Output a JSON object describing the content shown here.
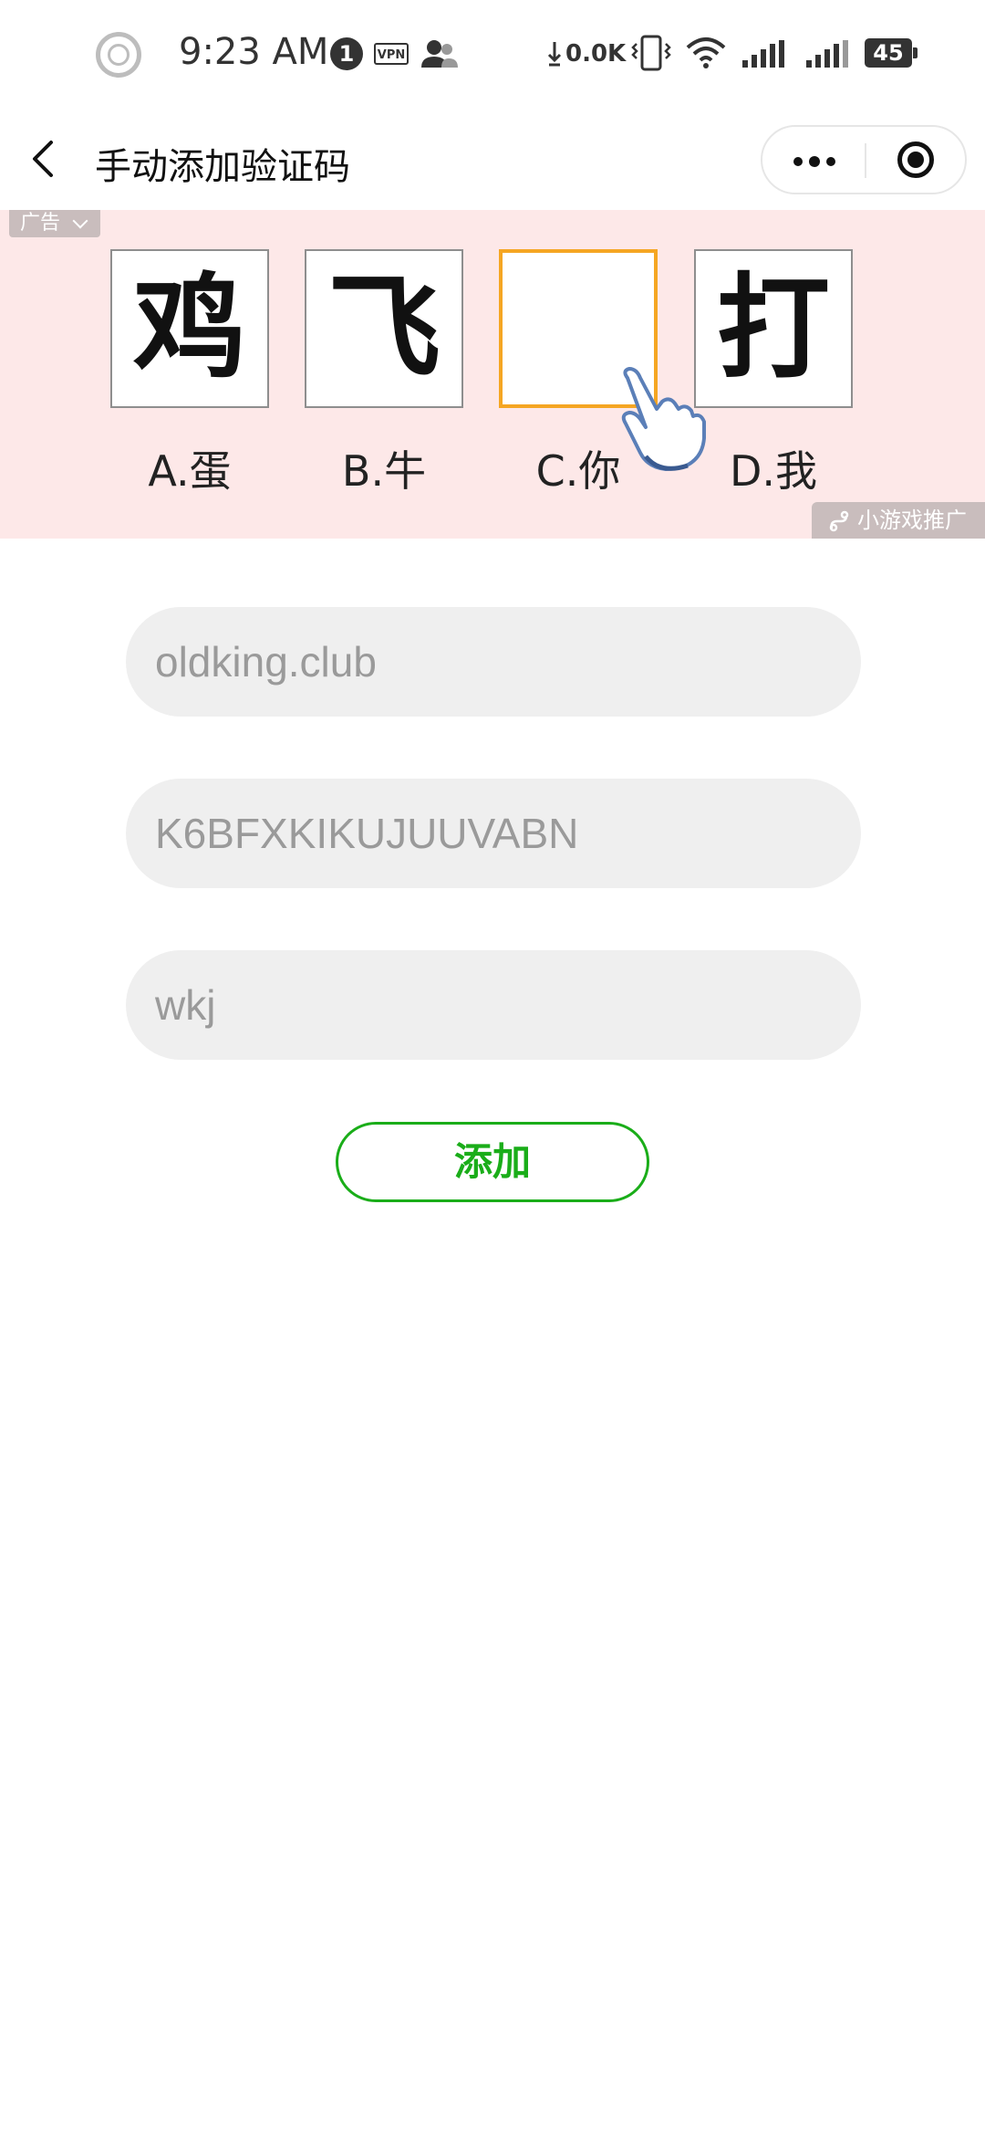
{
  "status_bar": {
    "time": "9:23 AM",
    "notification_count": "1",
    "vpn_label": "VPN",
    "net_speed": "0.0K",
    "battery": "45"
  },
  "nav": {
    "title": "手动添加验证码"
  },
  "ad": {
    "tag_label": "广告",
    "chars": [
      "鸡",
      "飞",
      "",
      "打"
    ],
    "options": [
      "A.蛋",
      "B.牛",
      "C.你",
      "D.我"
    ],
    "promo_label": "小游戏推广"
  },
  "form": {
    "field1_placeholder": "oldking.club",
    "field2_placeholder": "K6BFXKIKUJUUVABN",
    "field3_placeholder": "wkj",
    "add_label": "添加"
  },
  "colors": {
    "accent_green": "#1aad19",
    "ad_background": "#fde8e8",
    "highlight_orange": "#f5a623"
  }
}
